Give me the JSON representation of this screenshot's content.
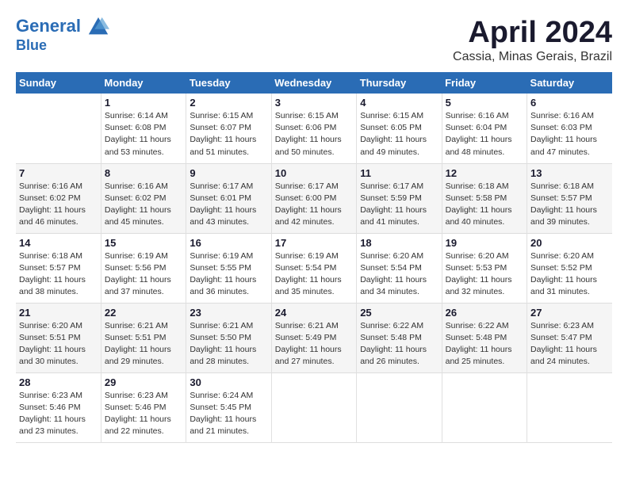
{
  "header": {
    "logo_line1": "General",
    "logo_line2": "Blue",
    "month": "April 2024",
    "location": "Cassia, Minas Gerais, Brazil"
  },
  "columns": [
    "Sunday",
    "Monday",
    "Tuesday",
    "Wednesday",
    "Thursday",
    "Friday",
    "Saturday"
  ],
  "weeks": [
    [
      {
        "day": "",
        "info": ""
      },
      {
        "day": "1",
        "info": "Sunrise: 6:14 AM\nSunset: 6:08 PM\nDaylight: 11 hours\nand 53 minutes."
      },
      {
        "day": "2",
        "info": "Sunrise: 6:15 AM\nSunset: 6:07 PM\nDaylight: 11 hours\nand 51 minutes."
      },
      {
        "day": "3",
        "info": "Sunrise: 6:15 AM\nSunset: 6:06 PM\nDaylight: 11 hours\nand 50 minutes."
      },
      {
        "day": "4",
        "info": "Sunrise: 6:15 AM\nSunset: 6:05 PM\nDaylight: 11 hours\nand 49 minutes."
      },
      {
        "day": "5",
        "info": "Sunrise: 6:16 AM\nSunset: 6:04 PM\nDaylight: 11 hours\nand 48 minutes."
      },
      {
        "day": "6",
        "info": "Sunrise: 6:16 AM\nSunset: 6:03 PM\nDaylight: 11 hours\nand 47 minutes."
      }
    ],
    [
      {
        "day": "7",
        "info": "Sunrise: 6:16 AM\nSunset: 6:02 PM\nDaylight: 11 hours\nand 46 minutes."
      },
      {
        "day": "8",
        "info": "Sunrise: 6:16 AM\nSunset: 6:02 PM\nDaylight: 11 hours\nand 45 minutes."
      },
      {
        "day": "9",
        "info": "Sunrise: 6:17 AM\nSunset: 6:01 PM\nDaylight: 11 hours\nand 43 minutes."
      },
      {
        "day": "10",
        "info": "Sunrise: 6:17 AM\nSunset: 6:00 PM\nDaylight: 11 hours\nand 42 minutes."
      },
      {
        "day": "11",
        "info": "Sunrise: 6:17 AM\nSunset: 5:59 PM\nDaylight: 11 hours\nand 41 minutes."
      },
      {
        "day": "12",
        "info": "Sunrise: 6:18 AM\nSunset: 5:58 PM\nDaylight: 11 hours\nand 40 minutes."
      },
      {
        "day": "13",
        "info": "Sunrise: 6:18 AM\nSunset: 5:57 PM\nDaylight: 11 hours\nand 39 minutes."
      }
    ],
    [
      {
        "day": "14",
        "info": "Sunrise: 6:18 AM\nSunset: 5:57 PM\nDaylight: 11 hours\nand 38 minutes."
      },
      {
        "day": "15",
        "info": "Sunrise: 6:19 AM\nSunset: 5:56 PM\nDaylight: 11 hours\nand 37 minutes."
      },
      {
        "day": "16",
        "info": "Sunrise: 6:19 AM\nSunset: 5:55 PM\nDaylight: 11 hours\nand 36 minutes."
      },
      {
        "day": "17",
        "info": "Sunrise: 6:19 AM\nSunset: 5:54 PM\nDaylight: 11 hours\nand 35 minutes."
      },
      {
        "day": "18",
        "info": "Sunrise: 6:20 AM\nSunset: 5:54 PM\nDaylight: 11 hours\nand 34 minutes."
      },
      {
        "day": "19",
        "info": "Sunrise: 6:20 AM\nSunset: 5:53 PM\nDaylight: 11 hours\nand 32 minutes."
      },
      {
        "day": "20",
        "info": "Sunrise: 6:20 AM\nSunset: 5:52 PM\nDaylight: 11 hours\nand 31 minutes."
      }
    ],
    [
      {
        "day": "21",
        "info": "Sunrise: 6:20 AM\nSunset: 5:51 PM\nDaylight: 11 hours\nand 30 minutes."
      },
      {
        "day": "22",
        "info": "Sunrise: 6:21 AM\nSunset: 5:51 PM\nDaylight: 11 hours\nand 29 minutes."
      },
      {
        "day": "23",
        "info": "Sunrise: 6:21 AM\nSunset: 5:50 PM\nDaylight: 11 hours\nand 28 minutes."
      },
      {
        "day": "24",
        "info": "Sunrise: 6:21 AM\nSunset: 5:49 PM\nDaylight: 11 hours\nand 27 minutes."
      },
      {
        "day": "25",
        "info": "Sunrise: 6:22 AM\nSunset: 5:48 PM\nDaylight: 11 hours\nand 26 minutes."
      },
      {
        "day": "26",
        "info": "Sunrise: 6:22 AM\nSunset: 5:48 PM\nDaylight: 11 hours\nand 25 minutes."
      },
      {
        "day": "27",
        "info": "Sunrise: 6:23 AM\nSunset: 5:47 PM\nDaylight: 11 hours\nand 24 minutes."
      }
    ],
    [
      {
        "day": "28",
        "info": "Sunrise: 6:23 AM\nSunset: 5:46 PM\nDaylight: 11 hours\nand 23 minutes."
      },
      {
        "day": "29",
        "info": "Sunrise: 6:23 AM\nSunset: 5:46 PM\nDaylight: 11 hours\nand 22 minutes."
      },
      {
        "day": "30",
        "info": "Sunrise: 6:24 AM\nSunset: 5:45 PM\nDaylight: 11 hours\nand 21 minutes."
      },
      {
        "day": "",
        "info": ""
      },
      {
        "day": "",
        "info": ""
      },
      {
        "day": "",
        "info": ""
      },
      {
        "day": "",
        "info": ""
      }
    ]
  ]
}
